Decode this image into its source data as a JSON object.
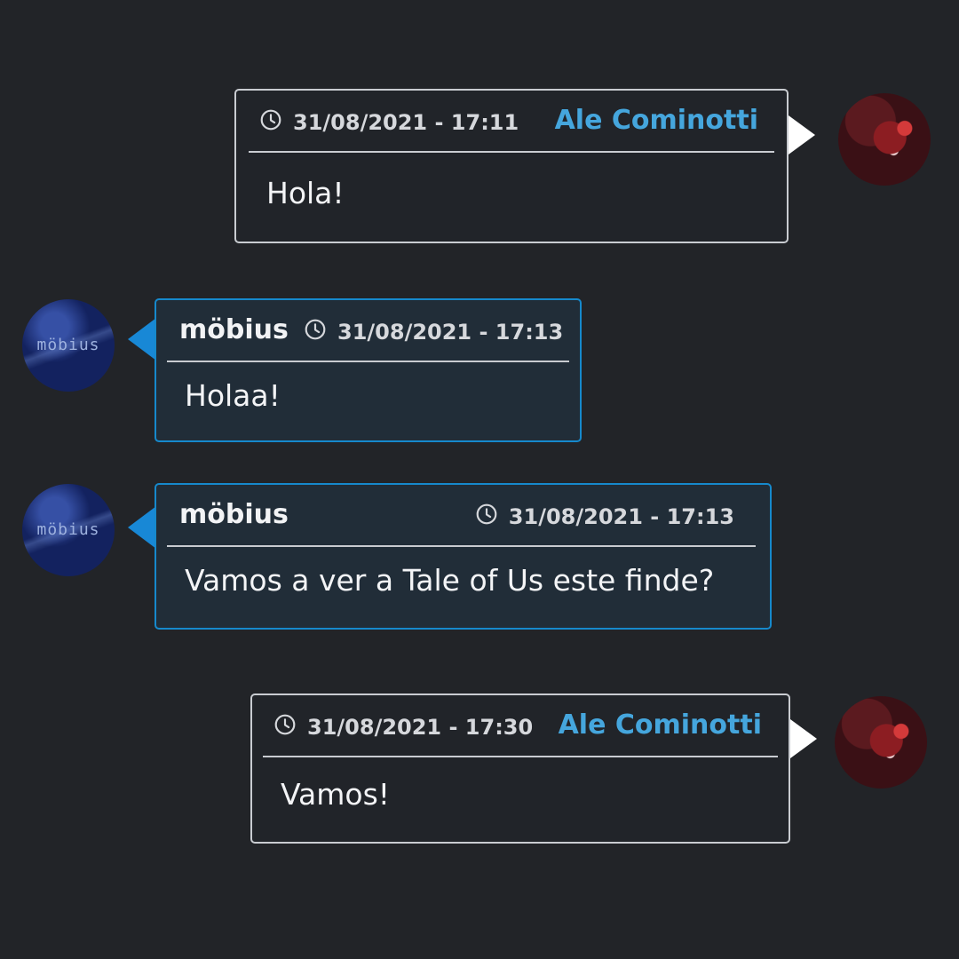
{
  "messages": [
    {
      "sender": "Ale Cominotti",
      "timestamp": "31/08/2021 - 17:11",
      "text": "Hola!",
      "direction": "outgoing",
      "avatar": "Ale Cominotti avatar"
    },
    {
      "sender": "möbius",
      "timestamp": "31/08/2021 - 17:13",
      "text": "Holaa!",
      "direction": "incoming",
      "avatar_text": "möbius"
    },
    {
      "sender": "möbius",
      "timestamp": "31/08/2021 - 17:13",
      "text": "Vamos a ver a Tale of Us este finde?",
      "direction": "incoming",
      "avatar_text": "möbius"
    },
    {
      "sender": "Ale Cominotti",
      "timestamp": "31/08/2021 - 17:30",
      "text": "Vamos!",
      "direction": "outgoing",
      "avatar": "Ale Cominotti avatar"
    }
  ],
  "icons": {
    "timestamp": "clock-icon"
  },
  "colors": {
    "background": "#222428",
    "outgoing_border": "#c9ccd1",
    "incoming_border": "#1689cc",
    "incoming_background": "#212d38",
    "outgoing_name": "#45a6dd",
    "incoming_tail": "#1888d6"
  }
}
